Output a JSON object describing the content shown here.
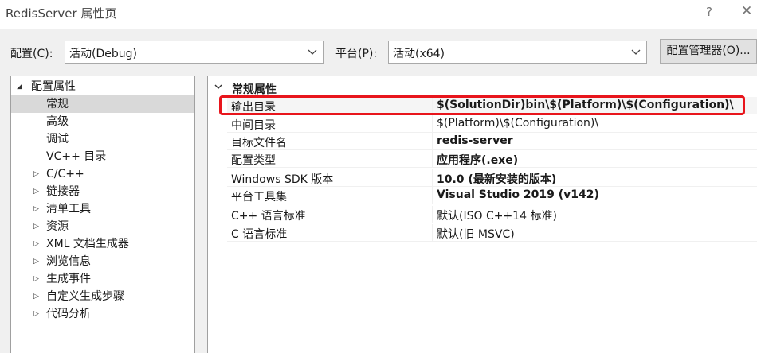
{
  "window": {
    "title": "RedisServer 属性页",
    "help_label": "?",
    "close_label": "✕"
  },
  "toolbar": {
    "config_label": "配置(C):",
    "config_value": "活动(Debug)",
    "platform_label": "平台(P):",
    "platform_value": "活动(x64)",
    "config_manager_label": "配置管理器(O)..."
  },
  "tree": {
    "root": {
      "label": "配置属性",
      "expanded": true
    },
    "items": [
      {
        "label": "常规",
        "selected": true
      },
      {
        "label": "高级"
      },
      {
        "label": "调试"
      },
      {
        "label": "VC++ 目录"
      },
      {
        "label": "C/C++",
        "collapsed": true
      },
      {
        "label": "链接器",
        "collapsed": true
      },
      {
        "label": "清单工具",
        "collapsed": true
      },
      {
        "label": "资源",
        "collapsed": true
      },
      {
        "label": "XML 文档生成器",
        "collapsed": true
      },
      {
        "label": "浏览信息",
        "collapsed": true
      },
      {
        "label": "生成事件",
        "collapsed": true
      },
      {
        "label": "自定义生成步骤",
        "collapsed": true
      },
      {
        "label": "代码分析",
        "collapsed": true
      }
    ]
  },
  "grid": {
    "category": "常规属性",
    "rows": [
      {
        "name": "输出目录",
        "value": "$(SolutionDir)bin\\$(Platform)\\$(Configuration)\\",
        "bold": true
      },
      {
        "name": "中间目录",
        "value": "$(Platform)\\$(Configuration)\\",
        "bold": false
      },
      {
        "name": "目标文件名",
        "value": "redis-server",
        "bold": true
      },
      {
        "name": "配置类型",
        "value": "应用程序(.exe)",
        "bold": true
      },
      {
        "name": "Windows SDK 版本",
        "value": "10.0 (最新安装的版本)",
        "bold": true
      },
      {
        "name": "平台工具集",
        "value": "Visual Studio 2019 (v142)",
        "bold": true
      },
      {
        "name": "C++ 语言标准",
        "value": "默认(ISO C++14 标准)",
        "bold": false
      },
      {
        "name": "C 语言标准",
        "value": "默认(旧 MSVC)",
        "bold": false
      }
    ]
  },
  "colors": {
    "highlight": "#e8151c",
    "selection": "#d9d9d9"
  }
}
